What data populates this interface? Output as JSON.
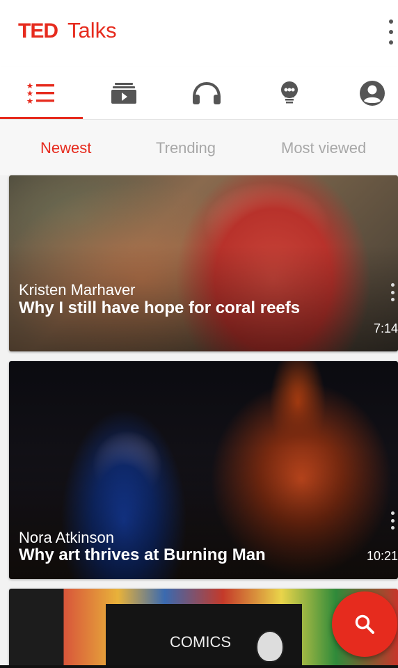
{
  "brand": {
    "ted": "TED",
    "talks": "Talks"
  },
  "colors": {
    "accent": "#e62b1e",
    "inactive_tab": "#a8a8a8",
    "icon": "#555555"
  },
  "nav": {
    "active_index": 0,
    "items": [
      {
        "icon": "talk-list-icon"
      },
      {
        "icon": "playlists-icon"
      },
      {
        "icon": "headphones-icon"
      },
      {
        "icon": "lightbulb-icon"
      },
      {
        "icon": "account-icon"
      }
    ]
  },
  "tabs": [
    {
      "label": "Newest",
      "active": true
    },
    {
      "label": "Trending",
      "active": false
    },
    {
      "label": "Most viewed",
      "active": false
    }
  ],
  "talks": [
    {
      "speaker": "Kristen Marhaver",
      "title": "Why I still have hope for coral reefs",
      "duration": "7:14"
    },
    {
      "speaker": "Nora Atkinson",
      "title": "Why art thrives at Burning Man",
      "duration": "10:21"
    },
    {
      "panel_text": "COMICS"
    }
  ],
  "fab": {
    "icon": "search-icon"
  }
}
